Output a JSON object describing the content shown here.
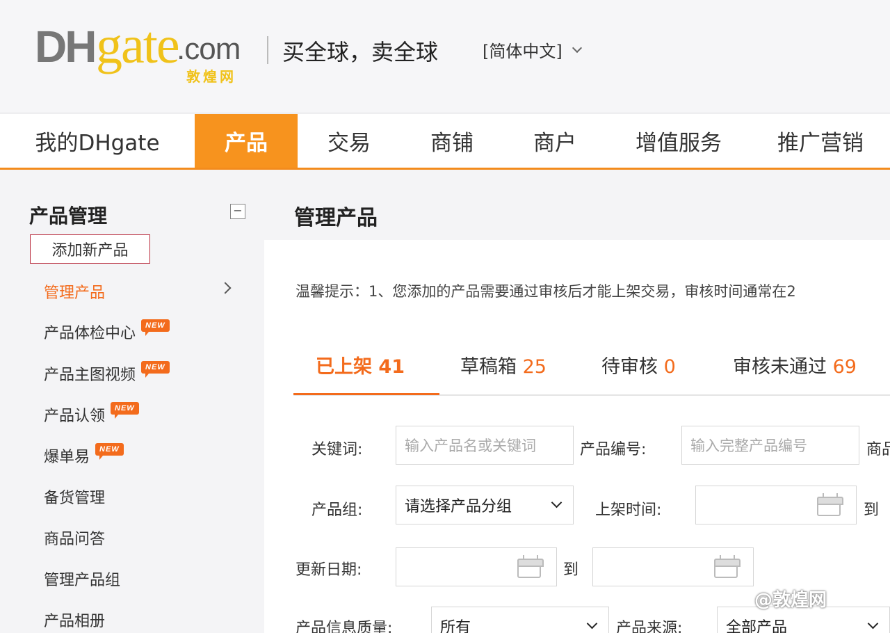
{
  "header": {
    "logo_dh": "DH",
    "logo_gate": "gate",
    "logo_com": ".com",
    "logo_cn": "敦煌网",
    "slogan": "买全球，卖全球",
    "language": "[简体中文]"
  },
  "nav": {
    "items": [
      {
        "label": "我的DHgate"
      },
      {
        "label": "产品"
      },
      {
        "label": "交易"
      },
      {
        "label": "商铺"
      },
      {
        "label": "商户"
      },
      {
        "label": "增值服务"
      },
      {
        "label": "推广营销"
      }
    ]
  },
  "sidebar": {
    "title": "产品管理",
    "collapse": "−",
    "add_button": "添加新产品",
    "items": [
      {
        "label": "管理产品"
      },
      {
        "label": "产品体检中心",
        "badge": "NEW"
      },
      {
        "label": "产品主图视频",
        "badge": "NEW"
      },
      {
        "label": "产品认领",
        "badge": "NEW"
      },
      {
        "label": "爆单易",
        "badge": "NEW"
      },
      {
        "label": "备货管理"
      },
      {
        "label": "商品问答"
      },
      {
        "label": "管理产品组"
      },
      {
        "label": "产品相册"
      }
    ]
  },
  "main": {
    "title": "管理产品",
    "notice": "温馨提示：1、您添加的产品需要通过审核后才能上架交易，审核时间通常在2",
    "tabs": [
      {
        "label": "已上架",
        "count": "41"
      },
      {
        "label": "草稿箱",
        "count": "25"
      },
      {
        "label": "待审核",
        "count": "0"
      },
      {
        "label": "审核未通过",
        "count": "69"
      }
    ],
    "filters": {
      "keyword_label": "关键词:",
      "keyword_placeholder": "输入产品名或关键词",
      "product_no_label": "产品编号:",
      "product_no_placeholder": "输入完整产品编号",
      "goods_label": "商品",
      "group_label": "产品组:",
      "group_value": "请选择产品分组",
      "listing_time_label": "上架时间:",
      "to1": "到",
      "update_label": "更新日期:",
      "to2": "到",
      "quality_label": "产品信息质量:",
      "quality_value": "所有",
      "source_label": "产品来源:",
      "source_value": "全部产品"
    }
  },
  "watermark": "@敦煌网"
}
